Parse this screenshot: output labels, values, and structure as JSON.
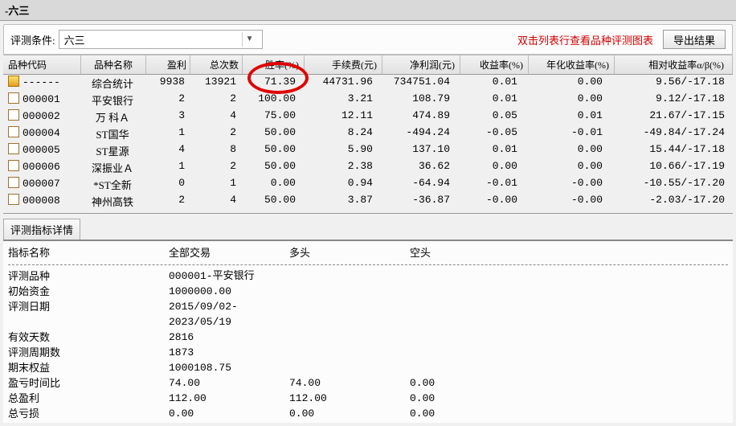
{
  "window_title": "-六三",
  "filter": {
    "label": "评测条件:",
    "value": "六三"
  },
  "table_hint": "双击列表行查看品种评测图表",
  "export_label": "导出结果",
  "headers": [
    "品种代码",
    "品种名称",
    "盈利",
    "总次数",
    "胜率(%)",
    "手续费(元)",
    "净利润(元)",
    "收益率(%)",
    "年化收益率(%)",
    "相对收益率α/β(%)"
  ],
  "rows": [
    {
      "code": "------",
      "name": "综合统计",
      "wins": "9938",
      "total": "13921",
      "winrate": "71.39",
      "fee": "44731.96",
      "profit": "734751.04",
      "ret": "0.01",
      "annret": "0.00",
      "alpha": "9.56/-17.18",
      "gold": true
    },
    {
      "code": "000001",
      "name": "平安银行",
      "wins": "2",
      "total": "2",
      "winrate": "100.00",
      "fee": "3.21",
      "profit": "108.79",
      "ret": "0.01",
      "annret": "0.00",
      "alpha": "9.12/-17.18"
    },
    {
      "code": "000002",
      "name": "万 科Ａ",
      "wins": "3",
      "total": "4",
      "winrate": "75.00",
      "fee": "12.11",
      "profit": "474.89",
      "ret": "0.05",
      "annret": "0.01",
      "alpha": "21.67/-17.15"
    },
    {
      "code": "000004",
      "name": "ST国华",
      "wins": "1",
      "total": "2",
      "winrate": "50.00",
      "fee": "8.24",
      "profit": "-494.24",
      "ret": "-0.05",
      "annret": "-0.01",
      "alpha": "-49.84/-17.24"
    },
    {
      "code": "000005",
      "name": "ST星源",
      "wins": "4",
      "total": "8",
      "winrate": "50.00",
      "fee": "5.90",
      "profit": "137.10",
      "ret": "0.01",
      "annret": "0.00",
      "alpha": "15.44/-17.18"
    },
    {
      "code": "000006",
      "name": "深振业Ａ",
      "wins": "1",
      "total": "2",
      "winrate": "50.00",
      "fee": "2.38",
      "profit": "36.62",
      "ret": "0.00",
      "annret": "0.00",
      "alpha": "10.66/-17.19"
    },
    {
      "code": "000007",
      "name": "*ST全新",
      "wins": "0",
      "total": "1",
      "winrate": "0.00",
      "fee": "0.94",
      "profit": "-64.94",
      "ret": "-0.01",
      "annret": "-0.00",
      "alpha": "-10.55/-17.20"
    },
    {
      "code": "000008",
      "name": "神州高铁",
      "wins": "2",
      "total": "4",
      "winrate": "50.00",
      "fee": "3.87",
      "profit": "-36.87",
      "ret": "-0.00",
      "annret": "-0.00",
      "alpha": "-2.03/-17.20"
    }
  ],
  "section_title": "评测指标详情",
  "detail_headers": [
    "指标名称",
    "全部交易",
    "多头",
    "空头"
  ],
  "details": [
    {
      "name": "评测品种",
      "v1": "000001-平安银行"
    },
    {
      "name": "初始资金",
      "v1": "1000000.00"
    },
    {
      "name": "评测日期",
      "v1": "2015/09/02-2023/05/19"
    },
    {
      "name": "有效天数",
      "v1": "2816"
    },
    {
      "name": "评测周期数",
      "v1": "1873"
    },
    {
      "name": "期末权益",
      "v1": "1000108.75"
    },
    {
      "name": "盈亏时间比",
      "v1": "74.00",
      "v2": "74.00",
      "v3": "0.00"
    },
    {
      "name": "总盈利",
      "v1": "112.00",
      "v2": "112.00",
      "v3": "0.00"
    },
    {
      "name": "总亏损",
      "v1": "0.00",
      "v2": "0.00",
      "v3": "0.00"
    }
  ]
}
